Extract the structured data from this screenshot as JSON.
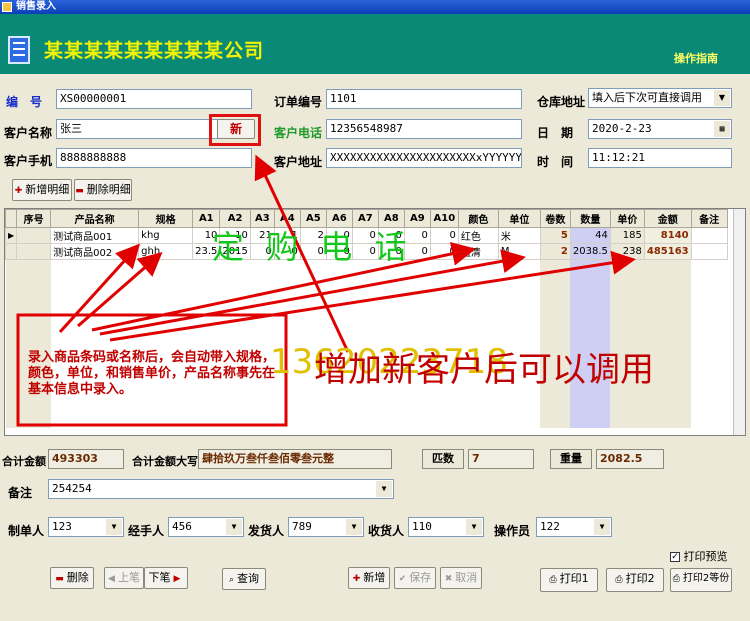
{
  "window": {
    "title": "销售录入"
  },
  "header": {
    "company": "某某某某某某某某某公司",
    "guide": "操作指南"
  },
  "form": {
    "code_label": "编　号",
    "code": "XS00000001",
    "order_label": "订单编号",
    "order": "1101",
    "warehouse_label": "仓库地址",
    "warehouse": "填入后下次可直接调用",
    "customer_label": "客户名称",
    "customer": "张三",
    "new_label": "新",
    "phone_label": "客户电话",
    "phone": "12356548987",
    "date_label": "日　期",
    "date": "2020-2-23",
    "mobile_label": "客户手机",
    "mobile": "8888888888",
    "address_label": "客户地址",
    "address": "XXXXXXXXXXXXXXXXXXXXXXxYYYYYYYY",
    "time_label": "时　间",
    "time": "11:12:21"
  },
  "detail_buttons": {
    "add": "新增明细",
    "delete": "删除明细"
  },
  "table": {
    "columns": [
      "序号",
      "产品名称",
      "规格",
      "A1",
      "A2",
      "A3",
      "A4",
      "A5",
      "A6",
      "A7",
      "A8",
      "A9",
      "A10",
      "颜色",
      "单位",
      "卷数",
      "数量",
      "单价",
      "金额",
      "备注"
    ],
    "rows": [
      [
        "",
        "测试商品001",
        "khg",
        "10",
        "10",
        "21",
        "1",
        "2",
        "0",
        "0",
        "0",
        "0",
        "0",
        "红色",
        "米",
        "5",
        "44",
        "185",
        "8140",
        ""
      ],
      [
        "",
        "测试商品002",
        "ghh",
        "23.5",
        "2015",
        "0",
        "0",
        "0",
        "0",
        "0",
        "0",
        "0",
        "0",
        "蓝清",
        "M",
        "2",
        "2038.5",
        "238",
        "485163",
        ""
      ]
    ]
  },
  "totals": {
    "total_label": "合计金额",
    "total": "493303",
    "total_cn_label": "合计金额大写",
    "total_cn": "肆拾玖万叁仟叁佰零叁元整",
    "pieces_label": "匹数",
    "pieces": "7",
    "weight_label": "重量",
    "weight": "2082.5"
  },
  "remark": {
    "label": "备注",
    "value": "254254"
  },
  "staff": {
    "maker_label": "制单人",
    "maker": "123",
    "handler_label": "经手人",
    "handler": "456",
    "shipper_label": "发货人",
    "shipper": "789",
    "receiver_label": "收货人",
    "receiver": "110",
    "operator_label": "操作员",
    "operator": "122"
  },
  "print_preview": {
    "label": "打印预览",
    "checked": true
  },
  "buttons": {
    "delete": "删除",
    "prev": "上笔",
    "next": "下笔",
    "query": "查询",
    "new": "新增",
    "save": "保存",
    "cancel": "取消",
    "print1": "打印1",
    "print2": "打印2",
    "print2w": "打印2等份"
  },
  "annotations": {
    "overlay_phone": "定 购 电 话",
    "overlay_number": "13620223718",
    "overlay_tip": "增加新客户后可以调用",
    "note": "录入商品条码或名称后，会自动带入规格，颜色，单位，和销售单价，产品名称事先在 基本信息中录入。"
  }
}
